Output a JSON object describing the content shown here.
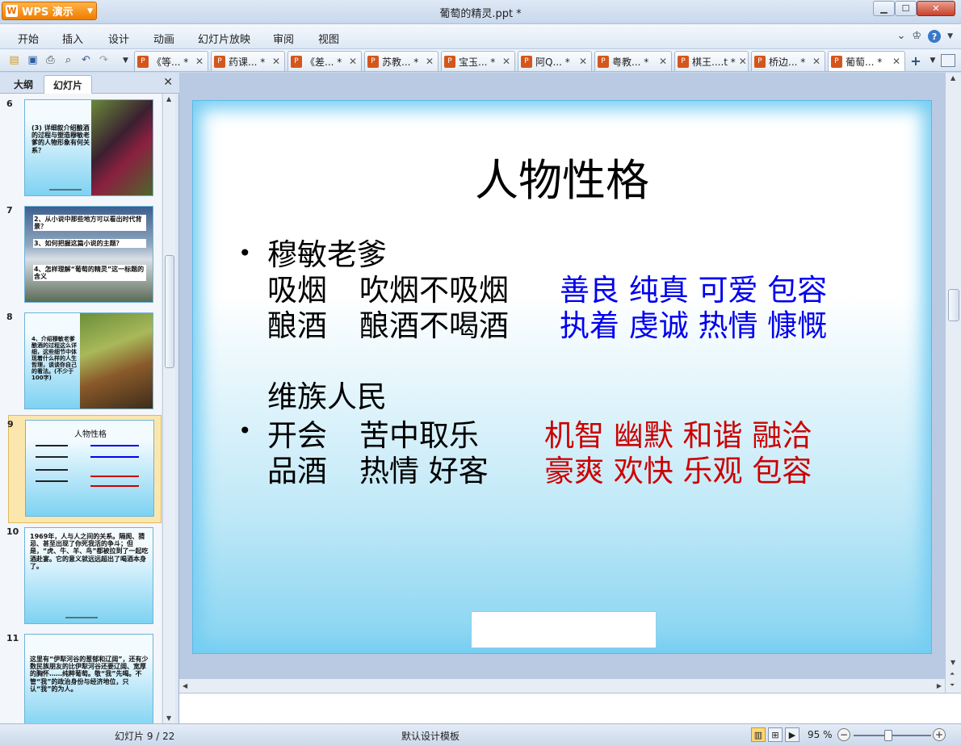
{
  "app": {
    "name": "WPS 演示",
    "window_title": "葡萄的精灵.ppt *"
  },
  "menu": [
    "开始",
    "插入",
    "设计",
    "动画",
    "幻灯片放映",
    "审阅",
    "视图"
  ],
  "tabs": [
    {
      "label": "《等...",
      "modified": "*"
    },
    {
      "label": "药课...",
      "modified": "*"
    },
    {
      "label": "《差...",
      "modified": "*"
    },
    {
      "label": "苏教...",
      "modified": "*"
    },
    {
      "label": "宝玉...",
      "modified": "*"
    },
    {
      "label": "阿Q...",
      "modified": "*"
    },
    {
      "label": "粤教...",
      "modified": "*"
    },
    {
      "label": "棋王....t",
      "modified": "*"
    },
    {
      "label": "桥边...",
      "modified": "*"
    },
    {
      "label": "葡萄...",
      "modified": "*"
    }
  ],
  "panel": {
    "outline_tab": "大纲",
    "slides_tab": "幻灯片",
    "thumbnails": [
      {
        "number": "6",
        "text": "(3) 详细叙介绍酿酒的过程与塑造穆敏老爹的人物形象有何关系？"
      },
      {
        "number": "7",
        "text": "2、从小说中那些地方可以看出时代背景？",
        "text2": "3、如何把握这篇小说的主题？",
        "text3": "4、怎样理解“葡萄的精灵”这一标题的含义"
      },
      {
        "number": "8",
        "text": "4、介绍穆敏老爹酿酒的过程这么详细，这些细节中体现着什么样的人生哲理，谈谈你自己的看法。(不少于100字)"
      },
      {
        "number": "9",
        "text": "人物性格"
      },
      {
        "number": "10",
        "text": "1969年，人与人之间的关系。隔阂、猜忌、甚至出现了你死我活的争斗；但是，“虎、牛、羊、鸟”都被拉到了一起吃酒赴宴。它的意义就远远超出了喝酒本身了。"
      },
      {
        "number": "11",
        "text": "这里有“伊犁河谷的葱郁和辽阔”，还有少数民族朋友的比伊犁河谷还要辽阔、宽厚的胸怀……纯粹葡萄。敬“我”先喝。不管“我”的政治身份与经济地位，只认“我”的为人。"
      }
    ]
  },
  "slide": {
    "title": "人物性格",
    "lines": {
      "s1_name": "穆敏老爹",
      "r1_a": "吸烟",
      "r1_b": "吹烟不吸烟",
      "r1_c": "善良 纯真 可爱 包容",
      "r2_a": "酿酒",
      "r2_b": "酿酒不喝酒",
      "r2_c": "执着 虔诚 热情 慷慨",
      "s2_name": "维族人民",
      "r3_a": "开会",
      "r3_b": "苦中取乐",
      "r3_c": "机智 幽默 和谐 融洽",
      "r4_a": "品酒",
      "r4_b": "热情  好客",
      "r4_c": "豪爽 欢快 乐观 包容"
    },
    "colors": {
      "blue": "#0000ee",
      "red": "#cc0000"
    }
  },
  "status": {
    "slide_info": "幻灯片 9 / 22",
    "template": "默认设计模板",
    "zoom": "95 %",
    "zoom_level_percent": 95
  }
}
